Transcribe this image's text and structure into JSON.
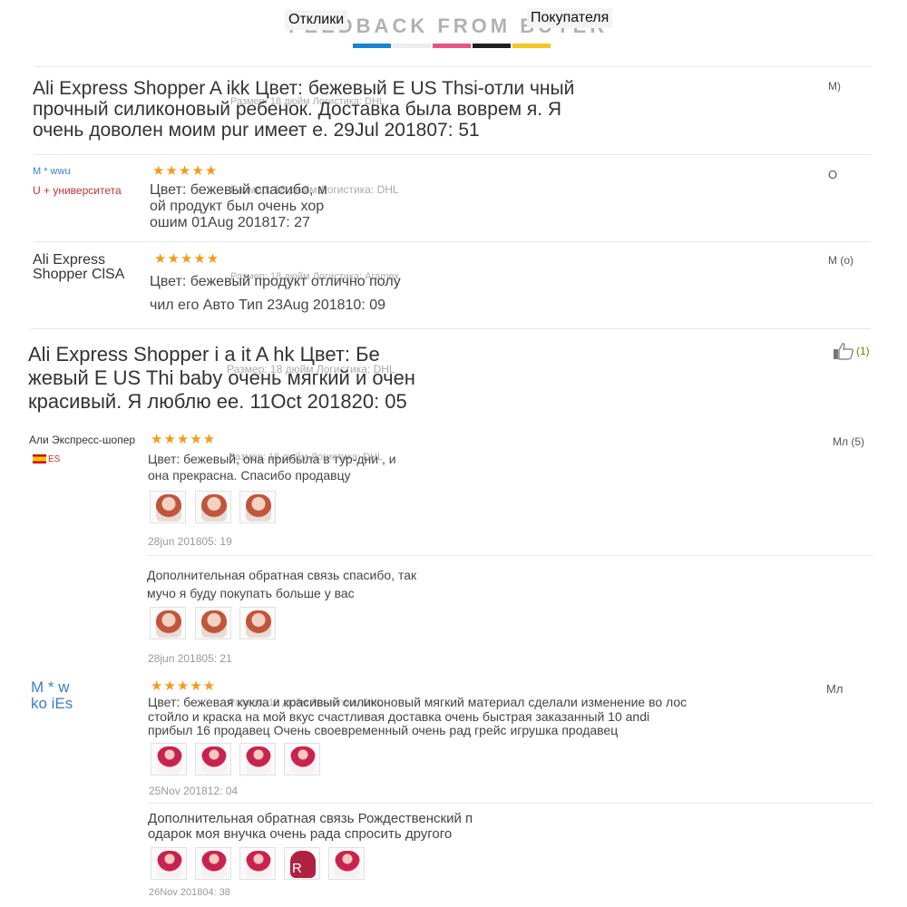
{
  "header": {
    "tab_feedback": "Отклики",
    "tab_buyer": "Покупателя",
    "ghost_text": "FEEDBACK FROM BUYER",
    "bar_colors": [
      "#1a84d0",
      "#eeeeee",
      "#e55585",
      "#1f1f1f",
      "#f3c623"
    ]
  },
  "reviews": [
    {
      "text": "Ali Express Shopper A ikk Цвет: бежевый E US Thsi-отли чный прочный силиконовый ребенок. Доставка была воврем я. Я очень доволен моим pur имеет е. 29Jul 201807: 51",
      "meta": "Размер: 18 дюйм Логистика: DHL",
      "side": "M)"
    },
    {
      "name1": "M * wwu",
      "name2": "U + университета",
      "stars": "★★★★★",
      "text": "Цвет: бежевый спасибо, м ой продукт был очень хор ошим 01Aug 201817: 27",
      "meta": "Размер: 18 дюйм Логистика: DHL",
      "side": "O"
    },
    {
      "name": "Ali Express Shopper ClSA",
      "stars": "★★★★★",
      "text": "Цвет: бежевый продукт отлично полу",
      "text2": "чил его Авто Тип 23Aug 201810: 09",
      "meta": "Размер: 18 дюйм Логистика: Aramex",
      "side": "M (o)"
    },
    {
      "text": "Ali Express Shopper i a it A hk Цвет: Бе жевый E US Thi baby очень мягкий и очен красивый. Я люблю ее. 11Oct 201820: 05",
      "meta": "Размер: 18 дюйм Логистика: DHL",
      "like_count": "(1)",
      "icon": "thumbs-up-icon"
    },
    {
      "name": "Али Экспресс-шопер",
      "country": "ES",
      "stars": "★★★★★",
      "text": "Цвет: бежевый, она прибыла в тур-дни , и она прекрасна. Спасибо продавцу",
      "meta": "Размер: 18 дюйм Логистика: DHL",
      "date": "28jun 201805: 19",
      "followup": "Дополнительная обратная связь спасибо, так мучо я буду покупать больше у вас",
      "followup_date": "28jun 201805: 21",
      "side": "Мл (5)"
    },
    {
      "name": "M * w ko iEs",
      "stars": "★★★★★",
      "text": "Цвет: бежевая кукла и красивый силиконовый мягкий материал сделали изменение во лос стойло и краска на мой вкус счастливая доставка очень быстрая заказанный 10 andi прибыл 16 продавец Очень своевременный очень рад грейс игрушка продавец",
      "meta": "Размер: 18 дюйм Логистика: DHL",
      "date": "25Nov 201812: 04",
      "followup": "Дополнительная обратная связь Рождественский п одарок моя внучка очень рада спросить другого",
      "followup_date": "26Nov 201804: 38",
      "badge": "R",
      "side": "Мл"
    }
  ]
}
